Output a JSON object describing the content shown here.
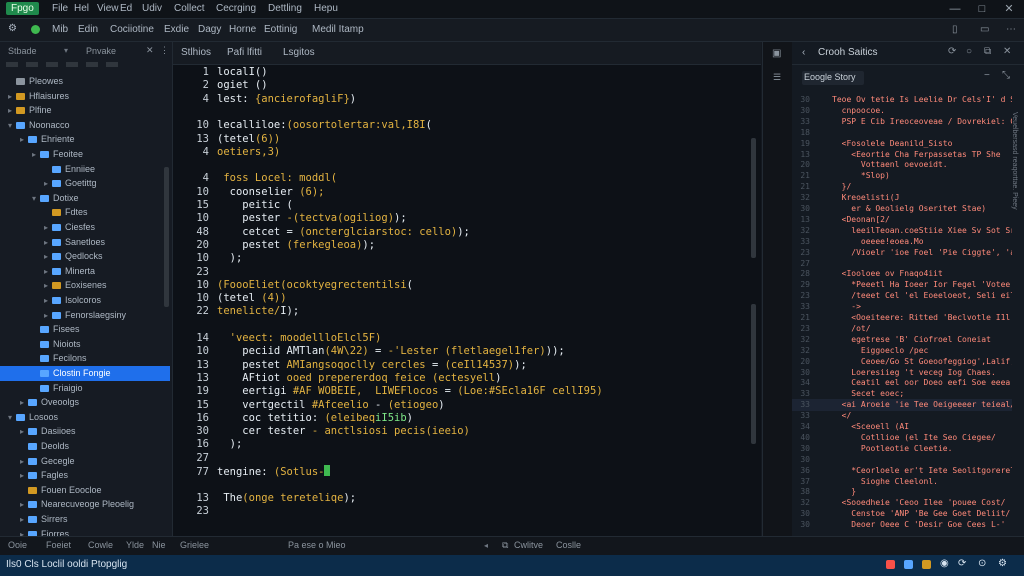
{
  "menubar": {
    "app_badge": "Fpgo",
    "items": [
      "File",
      "Hel",
      "View",
      "Ed",
      "Udiv",
      "Collect",
      "Cecrging",
      "Dettling",
      "Hepu"
    ]
  },
  "toolbar": {
    "items": [
      "Mib",
      "Edin",
      "Cociiotine",
      "Exdie",
      "Dagy",
      "Horne",
      "Eottinig",
      "Medil Itamp"
    ]
  },
  "sidebar": {
    "headers": [
      "Stbade",
      "Pnvake"
    ],
    "rows": [
      {
        "label": "Pleowes",
        "depth": 0,
        "color": "#8b949e",
        "chev": "",
        "selected": false
      },
      {
        "label": "Hflaisures",
        "depth": 0,
        "color": "#d29922",
        "chev": "▸",
        "selected": false
      },
      {
        "label": "Plfine",
        "depth": 0,
        "color": "#d29922",
        "chev": "▸",
        "selected": false
      },
      {
        "label": "Noonacco",
        "depth": 0,
        "color": "#58a6ff",
        "chev": "▾",
        "selected": false
      },
      {
        "label": "Ehriente",
        "depth": 1,
        "color": "#58a6ff",
        "chev": "▸",
        "selected": false
      },
      {
        "label": "Feoitee",
        "depth": 2,
        "color": "#58a6ff",
        "chev": "▸",
        "selected": false
      },
      {
        "label": "Enniiee",
        "depth": 3,
        "color": "#58a6ff",
        "chev": "",
        "selected": false
      },
      {
        "label": "Goetittg",
        "depth": 3,
        "color": "#58a6ff",
        "chev": "▸",
        "selected": false
      },
      {
        "label": "Dotixe",
        "depth": 2,
        "color": "#58a6ff",
        "chev": "▾",
        "selected": false
      },
      {
        "label": "Fdtes",
        "depth": 3,
        "color": "#d29922",
        "chev": "",
        "selected": false
      },
      {
        "label": "Ciesfes",
        "depth": 3,
        "color": "#58a6ff",
        "chev": "▸",
        "selected": false
      },
      {
        "label": "Sanetloes",
        "depth": 3,
        "color": "#58a6ff",
        "chev": "▸",
        "selected": false
      },
      {
        "label": "Qedlocks",
        "depth": 3,
        "color": "#58a6ff",
        "chev": "▸",
        "selected": false
      },
      {
        "label": "Minerta",
        "depth": 3,
        "color": "#58a6ff",
        "chev": "▸",
        "selected": false
      },
      {
        "label": "Eoxisenes",
        "depth": 3,
        "color": "#d29922",
        "chev": "▸",
        "selected": false
      },
      {
        "label": "Isolcoros",
        "depth": 3,
        "color": "#58a6ff",
        "chev": "▸",
        "selected": false
      },
      {
        "label": "Fenorslaegsiny",
        "depth": 3,
        "color": "#58a6ff",
        "chev": "▸",
        "selected": false
      },
      {
        "label": "Fisees",
        "depth": 2,
        "color": "#58a6ff",
        "chev": "",
        "selected": false
      },
      {
        "label": "Nioiots",
        "depth": 2,
        "color": "#58a6ff",
        "chev": "",
        "selected": false
      },
      {
        "label": "Fecilons",
        "depth": 2,
        "color": "#58a6ff",
        "chev": "",
        "selected": false
      },
      {
        "label": "Clostin Fongie",
        "depth": 2,
        "color": "#58a6ff",
        "chev": "",
        "selected": true
      },
      {
        "label": "Friaigio",
        "depth": 2,
        "color": "#58a6ff",
        "chev": "",
        "selected": false
      },
      {
        "label": "Oveoolgs",
        "depth": 1,
        "color": "#58a6ff",
        "chev": "▸",
        "selected": false
      },
      {
        "label": "Losoos",
        "depth": 0,
        "color": "#58a6ff",
        "chev": "▾",
        "selected": false
      },
      {
        "label": "Dasiioes",
        "depth": 1,
        "color": "#58a6ff",
        "chev": "▸",
        "selected": false
      },
      {
        "label": "Deolds",
        "depth": 1,
        "color": "#58a6ff",
        "chev": "",
        "selected": false
      },
      {
        "label": "Gecegle",
        "depth": 1,
        "color": "#58a6ff",
        "chev": "▸",
        "selected": false
      },
      {
        "label": "Fagles",
        "depth": 1,
        "color": "#58a6ff",
        "chev": "▸",
        "selected": false
      },
      {
        "label": "Fouen Eoocloe",
        "depth": 1,
        "color": "#d29922",
        "chev": "",
        "selected": false
      },
      {
        "label": "Nearecuveoge Pleoelig",
        "depth": 1,
        "color": "#58a6ff",
        "chev": "▸",
        "selected": false
      },
      {
        "label": "Sirrers",
        "depth": 1,
        "color": "#58a6ff",
        "chev": "▸",
        "selected": false
      },
      {
        "label": "Fiorres",
        "depth": 1,
        "color": "#58a6ff",
        "chev": "▸",
        "selected": false
      }
    ]
  },
  "editor": {
    "tabs": [
      "Stlhios",
      "Pafi lfitti",
      "Lsgitos"
    ],
    "lines": [
      {
        "ln": "1",
        "segs": [
          [
            "w",
            "localI()"
          ]
        ]
      },
      {
        "ln": "2",
        "segs": [
          [
            "w",
            "ogiet ()"
          ]
        ]
      },
      {
        "ln": "4",
        "segs": [
          [
            "w",
            "lest: "
          ],
          [
            "y",
            "{ancierofagliF}"
          ],
          [
            "w",
            ")"
          ]
        ]
      },
      {
        "ln": "",
        "segs": []
      },
      {
        "ln": "10",
        "segs": [
          [
            "w",
            "lecalliloe:"
          ],
          [
            "y",
            "(oosortolertar:val,I8I"
          ],
          [
            "w",
            "("
          ]
        ]
      },
      {
        "ln": "13",
        "segs": [
          [
            "w",
            "(tetel"
          ],
          [
            "y",
            "(6))"
          ]
        ]
      },
      {
        "ln": "4",
        "segs": [
          [
            "y",
            "oetiers,3)"
          ]
        ]
      },
      {
        "ln": "",
        "segs": []
      },
      {
        "ln": "4",
        "segs": [
          [
            "w",
            " "
          ],
          [
            "y",
            "foss Locel: moddl("
          ]
        ]
      },
      {
        "ln": "10",
        "segs": [
          [
            "w",
            "  coonselier "
          ],
          [
            "y",
            "(6);"
          ]
        ]
      },
      {
        "ln": "15",
        "segs": [
          [
            "w",
            "    peitic ("
          ]
        ]
      },
      {
        "ln": "10",
        "segs": [
          [
            "w",
            "    pester "
          ],
          [
            "y",
            "-(tectva(ogiliog)"
          ],
          [
            "w",
            ");"
          ]
        ]
      },
      {
        "ln": "48",
        "segs": [
          [
            "w",
            "    cetcet = "
          ],
          [
            "y",
            "(oncterglciarstoc: cello)"
          ],
          [
            "w",
            ");"
          ]
        ]
      },
      {
        "ln": "20",
        "segs": [
          [
            "w",
            "    pestet "
          ],
          [
            "y",
            "(ferkegleoa)"
          ],
          [
            "w",
            ");"
          ]
        ]
      },
      {
        "ln": "10",
        "segs": [
          [
            "w",
            "  );"
          ]
        ]
      },
      {
        "ln": "23",
        "segs": []
      },
      {
        "ln": "10",
        "segs": [
          [
            "y",
            "(FoooEliet(ocoktyegrectentilsi"
          ],
          [
            "w",
            "("
          ]
        ]
      },
      {
        "ln": "10",
        "segs": [
          [
            "w",
            "(tetel "
          ],
          [
            "y",
            "(4))"
          ]
        ]
      },
      {
        "ln": "22",
        "segs": [
          [
            "y",
            "tenelicte/"
          ],
          [
            "w",
            "I);"
          ]
        ]
      },
      {
        "ln": "",
        "segs": []
      },
      {
        "ln": "14",
        "segs": [
          [
            "w",
            "  "
          ],
          [
            "y",
            "'veect: moodellloElcl5F)"
          ]
        ]
      },
      {
        "ln": "10",
        "segs": [
          [
            "w",
            "    peciid AMTlan"
          ],
          [
            "y",
            "(4W\\22)"
          ],
          [
            "w",
            " = "
          ],
          [
            "y",
            "-'Lester (fletlaegel1fer)"
          ],
          [
            "w",
            "));"
          ]
        ]
      },
      {
        "ln": "13",
        "segs": [
          [
            "w",
            "    pestet "
          ],
          [
            "y",
            "AMIangsoqoclly cercles"
          ],
          [
            "w",
            " = "
          ],
          [
            "y",
            "(ceIl14537)"
          ],
          [
            "w",
            ");"
          ]
        ]
      },
      {
        "ln": "13",
        "segs": [
          [
            "w",
            "    AFtiot "
          ],
          [
            "y",
            "ooed prepererdoq feice (ectesyell"
          ],
          [
            "w",
            ")"
          ]
        ]
      },
      {
        "ln": "19",
        "segs": [
          [
            "w",
            "    eertigi "
          ],
          [
            "y",
            "#AF WOBEIE,"
          ],
          [
            "w",
            "  "
          ],
          [
            "y",
            "LIWEFlocos"
          ],
          [
            "w",
            " = "
          ],
          [
            "y",
            "(Loe:#SEcla16F cellI95)"
          ]
        ]
      },
      {
        "ln": "15",
        "segs": [
          [
            "w",
            "    vertgectil "
          ],
          [
            "y",
            "#Afceelio"
          ],
          [
            "w",
            " - "
          ],
          [
            "y",
            "(etiogeo"
          ],
          [
            "w",
            ")"
          ]
        ]
      },
      {
        "ln": "16",
        "segs": [
          [
            "w",
            "    coc tetitio: "
          ],
          [
            "y",
            "(eleibeq"
          ],
          [
            "g",
            "iI5ib"
          ],
          [
            "w",
            ")"
          ]
        ]
      },
      {
        "ln": "30",
        "segs": [
          [
            "w",
            "    cer tester "
          ],
          [
            "y",
            "- anctlsiosi pecis(ieeio)"
          ]
        ]
      },
      {
        "ln": "16",
        "segs": [
          [
            "w",
            "  );"
          ]
        ]
      },
      {
        "ln": "27",
        "segs": []
      },
      {
        "ln": "77",
        "segs": [
          [
            "w",
            "tengine: "
          ],
          [
            "y",
            "(Sotlus-"
          ],
          [
            "cur",
            ""
          ]
        ]
      },
      {
        "ln": "",
        "segs": []
      },
      {
        "ln": "13",
        "segs": [
          [
            "w",
            " The"
          ],
          [
            "y",
            "(onge tereteliqe"
          ],
          [
            "w",
            ");"
          ]
        ]
      },
      {
        "ln": "23",
        "segs": []
      }
    ]
  },
  "right_panel": {
    "title": "Crooh Saitics",
    "subtitle": "Eoogle Story",
    "vertical_label": "Veuelbersasd reaqorttae. Pieey",
    "lines": [
      {
        "ln": "30",
        "t": "Teoe Ov tetie Is Leelie Dr Cels'I' d Seloeebl I"
      },
      {
        "ln": "30",
        "t": "  cnpoocoe."
      },
      {
        "ln": "33",
        "t": "  PSP E Cib Ireoceoveae / Dovrekiel: Cios"
      },
      {
        "ln": "18",
        "t": ""
      },
      {
        "ln": "19",
        "t": "  <Fosolele Deanild_Sisto"
      },
      {
        "ln": "13",
        "t": "    <Eeortie Cha Ferpassetas TP She"
      },
      {
        "ln": "20",
        "t": "      Vottaenl oevoeidt."
      },
      {
        "ln": "21",
        "t": "      *Slop)"
      },
      {
        "ln": "21",
        "t": "  }/"
      },
      {
        "ln": "32",
        "t": "  Kreoelisti(J"
      },
      {
        "ln": "30",
        "t": "    er & Oeolielg Oseritet Stae)"
      },
      {
        "ln": "13",
        "t": "  <Deonan[2/"
      },
      {
        "ln": "32",
        "t": "    leeilTeoan.coeStiie Xiee Sv Sot Sr Si"
      },
      {
        "ln": "33",
        "t": "      oeeee!eoea.Mo"
      },
      {
        "ln": "23",
        "t": "    /Vioelr 'ioe Foel 'Pie Ciggte', 'a Ugalle"
      },
      {
        "ln": "27",
        "t": ""
      },
      {
        "ln": "28",
        "t": "  <Iooloee ov Fnaqo4iit"
      },
      {
        "ln": "29",
        "t": "    *Peeetl Ha Ioeer Ior Fegel 'Votee Eti"
      },
      {
        "ln": "23",
        "t": "    /teeet Cel 'el Eoeeloeot, Seli eiloe do"
      },
      {
        "ln": "33",
        "t": "    ->"
      },
      {
        "ln": "21",
        "t": "    <Ooeiteere: Ritted 'Beclvotle I1l idee"
      },
      {
        "ln": "23",
        "t": "    /ot/"
      },
      {
        "ln": "32",
        "t": "    egetrese 'B' Ciofroel Coneiat"
      },
      {
        "ln": "32",
        "t": "      Eiggoeclo /pec"
      },
      {
        "ln": "20",
        "t": "      Ceoee/Go St Goeoofeggiog',Lalif, Le"
      },
      {
        "ln": "30",
        "t": "    Loeresiieg 't veceg Iog Chaes."
      },
      {
        "ln": "34",
        "t": "    Ceatil eel oor Doeo eefi Soe eeea Ce"
      },
      {
        "ln": "33",
        "t": "    Secet eoec;"
      },
      {
        "ln": "33",
        "t": "  <ai Aroeie 'ie Tee Oeigeeeer teieal/lee"
      },
      {
        "ln": "33",
        "t": "  </"
      },
      {
        "ln": "34",
        "t": "    <Sceoell (AI"
      },
      {
        "ln": "40",
        "t": "      Cotllioe (el Ite Seo Ciegee/"
      },
      {
        "ln": "30",
        "t": "      Pootleotie Cleetie."
      },
      {
        "ln": "30",
        "t": ""
      },
      {
        "ln": "36",
        "t": "    *Ceorloele er't Iete Seolitgorerelle I"
      },
      {
        "ln": "37",
        "t": "      Sioghe Cleelonl."
      },
      {
        "ln": "38",
        "t": "    }"
      },
      {
        "ln": "32",
        "t": "  <Sooedheie 'Ceoo Ilee 'pouee Cost/"
      },
      {
        "ln": "30",
        "t": "    Censtoe 'ANP 'Be Gee Goet Deliit/ Te"
      },
      {
        "ln": "30",
        "t": "    Deoer Oeee C 'Desir Goe Cees L-'"
      }
    ]
  },
  "panelbar": {
    "items": [
      "Ooie",
      "Foeiet",
      "Cowle",
      "Ylde",
      "Nie",
      "Grielee"
    ],
    "center": "Pa ese o Mieo",
    "right_items": [
      "Cwlitve",
      "Coslle"
    ]
  },
  "statusbar": {
    "text": "Ils0 Cls Loclil ooldi Ptopglig"
  }
}
